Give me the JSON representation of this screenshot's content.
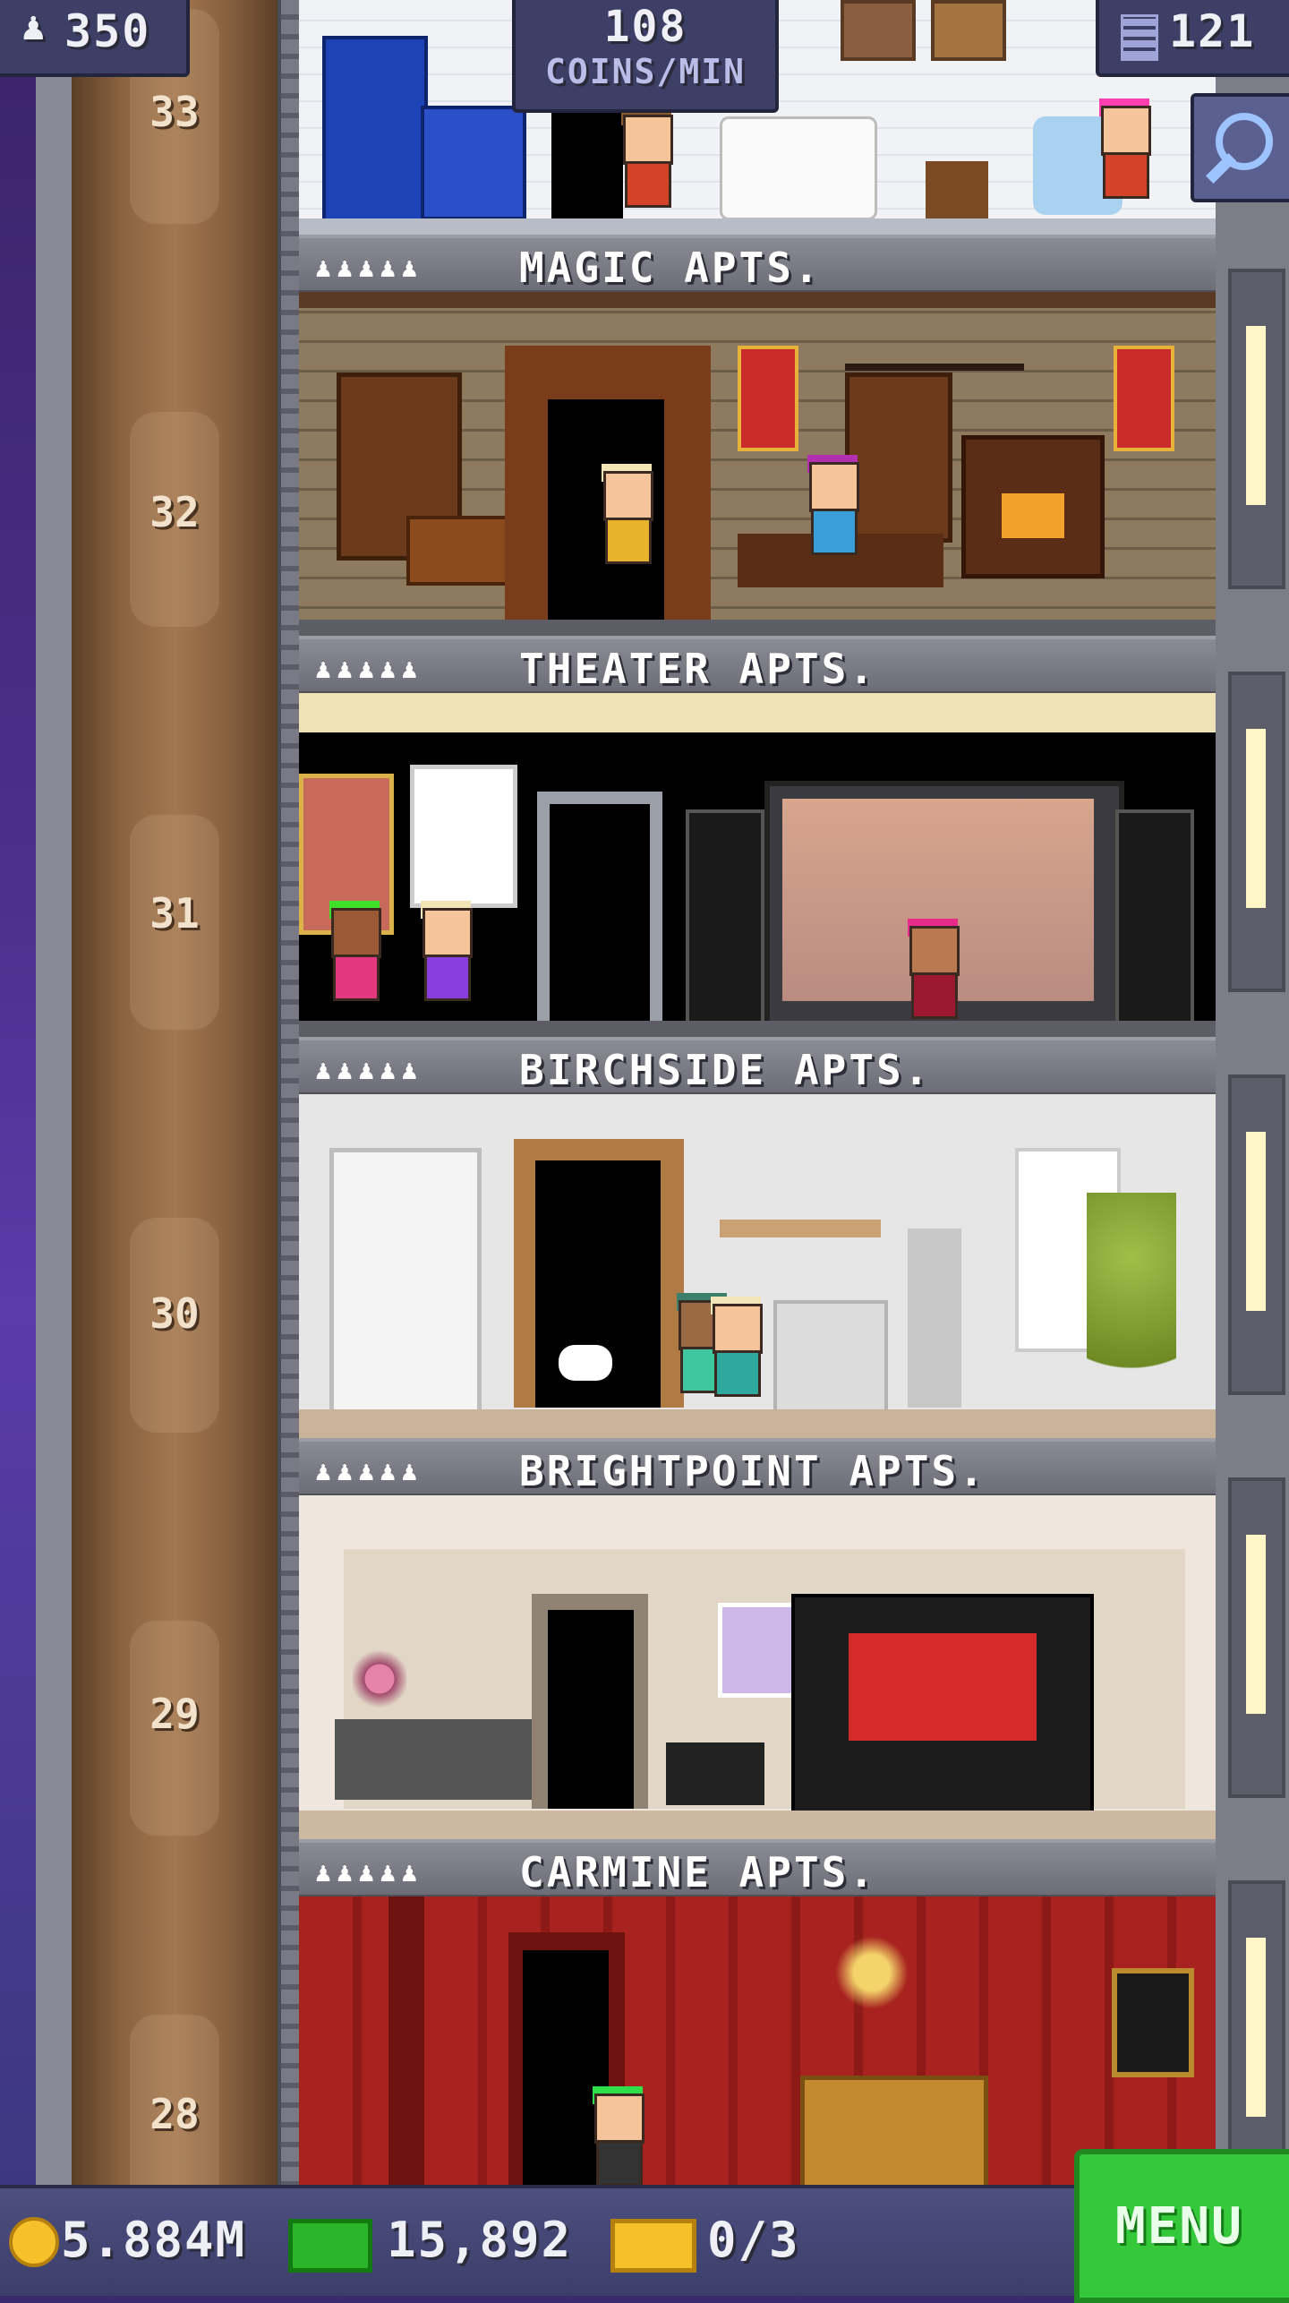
{
  "hud": {
    "population": "350",
    "coins_per_min_value": "108",
    "coins_per_min_label": "COINS/MIN",
    "floor_count": "121"
  },
  "icons": {
    "population": "person-icon",
    "floors": "building-icon",
    "search": "magnifier-icon",
    "coins": "coin-icon",
    "bux": "bux-banknote-icon",
    "tickets": "golden-ticket-icon"
  },
  "shaft_floor_numbers": [
    "33",
    "32",
    "31",
    "30",
    "29",
    "28"
  ],
  "floors": [
    {
      "name": "MAGIC APTS.",
      "occupancy": "♟♟♟♟♟"
    },
    {
      "name": "THEATER APTS.",
      "occupancy": "♟♟♟♟♟"
    },
    {
      "name": "BIRCHSIDE APTS.",
      "occupancy": "♟♟♟♟♟"
    },
    {
      "name": "BRIGHTPOINT APTS.",
      "occupancy": "♟♟♟♟♟"
    },
    {
      "name": "CARMINE APTS.",
      "occupancy": "♟♟♟♟♟"
    }
  ],
  "bottom": {
    "coins": "5.884M",
    "bux": "15,892",
    "tickets": "0/3",
    "menu_label": "MENU"
  },
  "colors": {
    "menu_green": "#35c83a",
    "hud_panel": "#3d3f66",
    "carmine_red": "#a8231f"
  }
}
